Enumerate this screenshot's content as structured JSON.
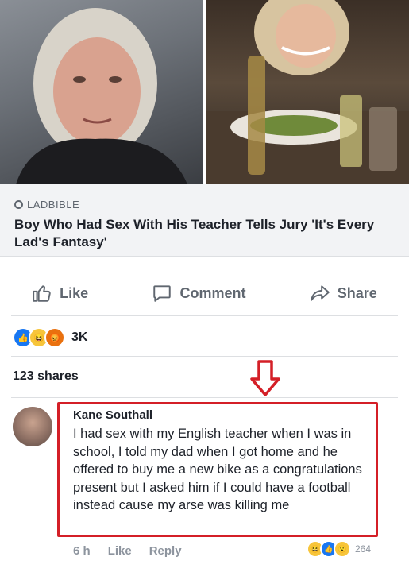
{
  "link_card": {
    "source": "LADBIBLE",
    "headline": "Boy Who Had Sex With His Teacher Tells Jury 'It's Every Lad's Fantasy'"
  },
  "actions": {
    "like_label": "Like",
    "comment_label": "Comment",
    "share_label": "Share"
  },
  "reactions": {
    "icons": [
      "like-icon",
      "haha-icon",
      "angry-icon"
    ],
    "count": "3K"
  },
  "shares": {
    "label": "123 shares"
  },
  "comment": {
    "author": "Kane Southall",
    "text": "I had sex with my English teacher when I was in school, I told my dad when I got home and he offered to buy me a new bike as a congratulations present but I asked him if I could have a football instead cause my arse was killing me",
    "time": "6 h",
    "like_label": "Like",
    "reply_label": "Reply",
    "reaction_icons": [
      "haha-icon",
      "like-icon",
      "wow-icon"
    ],
    "reaction_count": "264"
  },
  "colors": {
    "highlight_box": "#d41f27",
    "link_meta_bg": "#f2f3f5",
    "muted_text": "#606770"
  }
}
